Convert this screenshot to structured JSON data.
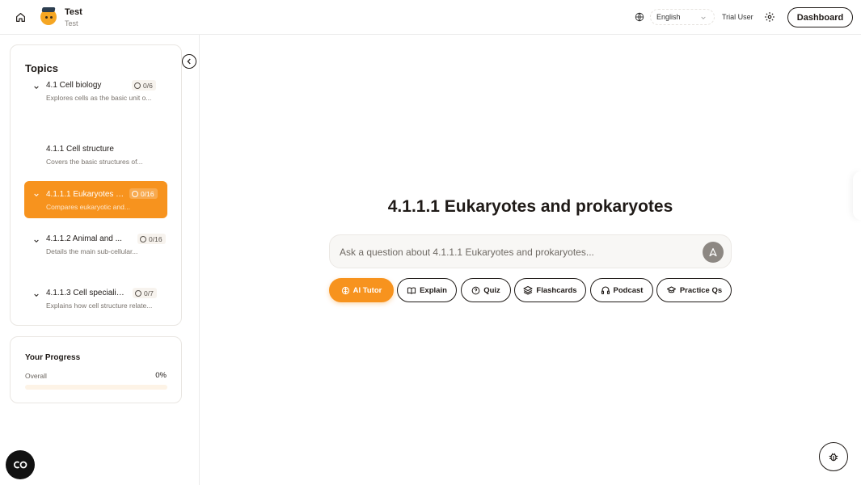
{
  "header": {
    "app_title": "Test",
    "app_subtitle": "Test",
    "language": "English",
    "user_name": "Trial User",
    "dashboard_label": "Dashboard"
  },
  "sidebar": {
    "topics_title": "Topics",
    "items": [
      {
        "name": "4.1 Cell biology",
        "desc": "Explores cells as the basic unit o...",
        "badge": "0/6",
        "expandable": true
      },
      {
        "name": "4.1.1 Cell structure",
        "desc": "Covers the basic structures of...",
        "badge": "",
        "expandable": false
      },
      {
        "name": "4.1.1.1 Eukaryotes a...",
        "desc": "Compares eukaryotic and...",
        "badge": "0/16",
        "expandable": true,
        "active": true
      },
      {
        "name": "4.1.1.2 Animal and ...",
        "desc": "Details the main sub-cellular...",
        "badge": "0/16",
        "expandable": true
      },
      {
        "name": "4.1.1.3 Cell specialis...",
        "desc": "Explains how cell structure relate...",
        "badge": "0/7",
        "expandable": true
      }
    ],
    "progress": {
      "title": "Your Progress",
      "label": "Overall",
      "value_text": "0%",
      "value": 0
    }
  },
  "main": {
    "title": "4.1.1.1 Eukaryotes and prokaryotes",
    "ask_placeholder": "Ask a question about 4.1.1.1 Eukaryotes and prokaryotes...",
    "actions": [
      {
        "label": "AI Tutor",
        "icon": "brain-icon"
      },
      {
        "label": "Explain",
        "icon": "book-icon"
      },
      {
        "label": "Quiz",
        "icon": "question-icon"
      },
      {
        "label": "Flashcards",
        "icon": "layers-icon"
      },
      {
        "label": "Podcast",
        "icon": "headphones-icon"
      },
      {
        "label": "Practice Qs",
        "icon": "graduation-cap-icon"
      }
    ]
  },
  "colors": {
    "accent": "#f7931e",
    "text": "#1f1a17",
    "muted": "#7a746e"
  }
}
